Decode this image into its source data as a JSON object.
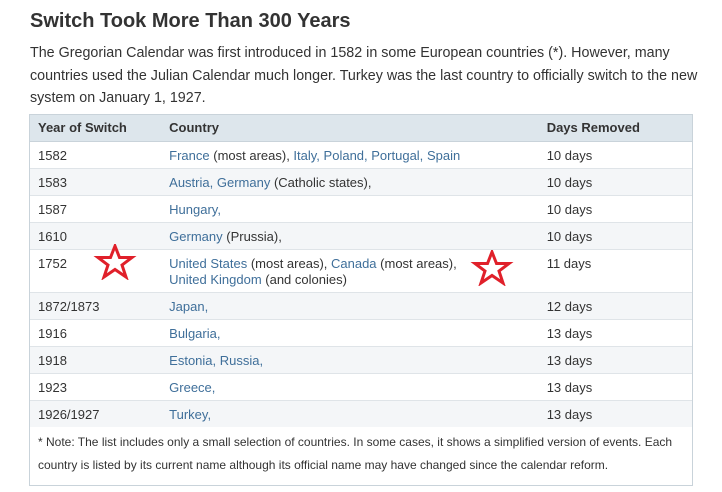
{
  "title": "Switch Took More Than 300 Years",
  "intro": "The Gregorian Calendar was first introduced in 1582 in some European countries (*). However, many countries used the Julian Calendar much longer. Turkey was the last country to officially switch to the new system on January 1, 1927.",
  "table": {
    "headers": [
      "Year of Switch",
      "Country",
      "Days Removed"
    ],
    "rows": [
      {
        "year": "1582",
        "days": "10 days",
        "country_parts": [
          {
            "t": "France",
            "link": true
          },
          {
            "t": " (most areas), ",
            "link": false
          },
          {
            "t": "Italy,",
            "link": true
          },
          {
            "t": " ",
            "link": false
          },
          {
            "t": "Poland,",
            "link": true
          },
          {
            "t": " ",
            "link": false
          },
          {
            "t": "Portugal,",
            "link": true
          },
          {
            "t": " ",
            "link": false
          },
          {
            "t": "Spain",
            "link": true
          }
        ]
      },
      {
        "year": "1583",
        "days": "10 days",
        "country_parts": [
          {
            "t": "Austria,",
            "link": true
          },
          {
            "t": " ",
            "link": false
          },
          {
            "t": "Germany",
            "link": true
          },
          {
            "t": " (Catholic states),",
            "link": false
          }
        ]
      },
      {
        "year": "1587",
        "days": "10 days",
        "country_parts": [
          {
            "t": "Hungary,",
            "link": true
          }
        ]
      },
      {
        "year": "1610",
        "days": "10 days",
        "country_parts": [
          {
            "t": "Germany",
            "link": true
          },
          {
            "t": " (Prussia),",
            "link": false
          }
        ]
      },
      {
        "year": "1752",
        "days": "11 days",
        "country_parts": [
          {
            "t": "United States",
            "link": true
          },
          {
            "t": " (most areas), ",
            "link": false
          },
          {
            "t": "Canada",
            "link": true
          },
          {
            "t": " (most areas),",
            "link": false
          },
          {
            "br": true
          },
          {
            "t": "United Kingdom",
            "link": true
          },
          {
            "t": " (and colonies)",
            "link": false
          }
        ]
      },
      {
        "year": "1872/1873",
        "days": "12 days",
        "country_parts": [
          {
            "t": "Japan,",
            "link": true
          }
        ]
      },
      {
        "year": "1916",
        "days": "13 days",
        "country_parts": [
          {
            "t": "Bulgaria,",
            "link": true
          }
        ]
      },
      {
        "year": "1918",
        "days": "13 days",
        "country_parts": [
          {
            "t": "Estonia,",
            "link": true
          },
          {
            "t": " ",
            "link": false
          },
          {
            "t": "Russia,",
            "link": true
          }
        ]
      },
      {
        "year": "1923",
        "days": "13 days",
        "country_parts": [
          {
            "t": "Greece,",
            "link": true
          }
        ]
      },
      {
        "year": "1926/1927",
        "days": "13 days",
        "country_parts": [
          {
            "t": "Turkey,",
            "link": true
          }
        ]
      }
    ]
  },
  "note": "* Note: The list includes only a small selection of countries. In some cases, it shows a simplified version of events. Each country is listed by its current name although its official name may have changed since the calendar reform.",
  "colors": {
    "link": "#3f6f9a",
    "header_bg": "#dde6ec",
    "star": "#e0202a"
  },
  "annotations": {
    "star_icon_names": [
      "star-icon",
      "star-icon"
    ]
  }
}
